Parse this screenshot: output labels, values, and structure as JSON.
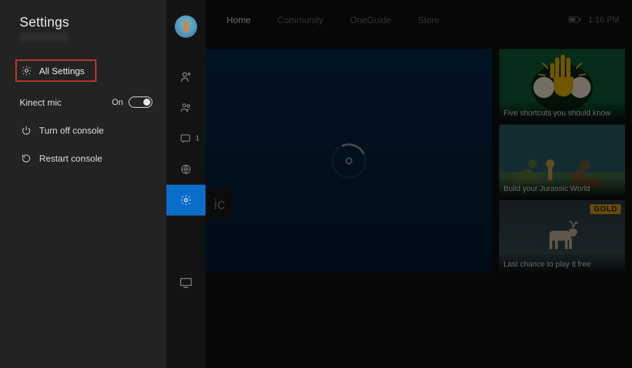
{
  "panel": {
    "title": "Settings",
    "all_settings": "All Settings",
    "kinect_label": "Kinect mic",
    "kinect_state": "On",
    "turn_off": "Turn off console",
    "restart": "Restart console"
  },
  "rail": {
    "messages_count": "1"
  },
  "nav": {
    "items": [
      "Home",
      "Community",
      "OneGuide",
      "Store"
    ],
    "active_index": 0,
    "time": "1:16 PM"
  },
  "hero": {
    "ic_text": "ic"
  },
  "cards": [
    {
      "caption": "Five shortcuts you should know"
    },
    {
      "caption": "Build your Jurassic World"
    },
    {
      "caption": "Last chance to play it free",
      "badge": "GOLD"
    }
  ]
}
